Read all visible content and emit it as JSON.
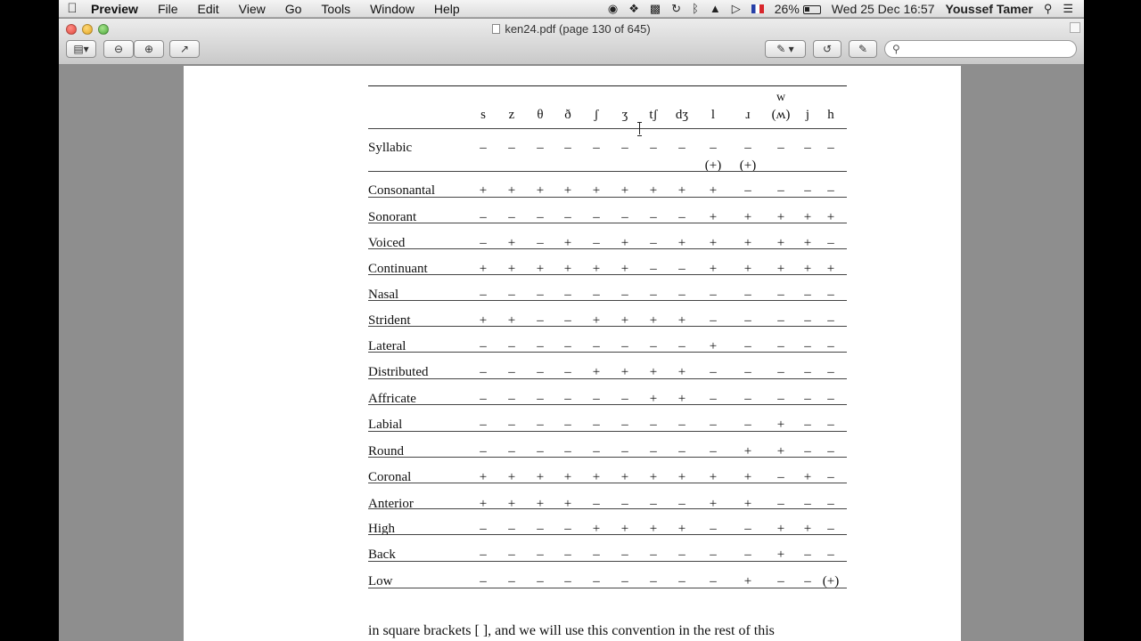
{
  "menubar": {
    "app_name": "Preview",
    "menus": [
      "File",
      "Edit",
      "View",
      "Go",
      "Tools",
      "Window",
      "Help"
    ],
    "battery": "26%",
    "datetime": "Wed 25 Dec  16:57",
    "user": "Youssef Tamer"
  },
  "window": {
    "title": "ken24.pdf (page 130 of 645)",
    "search_placeholder": ""
  },
  "table": {
    "w_superscript": "w",
    "symbols": [
      "s",
      "z",
      "θ",
      "ð",
      "ʃ",
      "ʒ",
      "tʃ",
      "dʒ",
      "l",
      "ɹ",
      "(ʍ)",
      "j",
      "h"
    ],
    "rows": [
      {
        "feature": "Syllabic",
        "values": [
          "–",
          "–",
          "–",
          "–",
          "–",
          "–",
          "–",
          "–",
          "–",
          "–",
          "–",
          "–",
          "–"
        ],
        "sub": [
          "",
          "",
          "",
          "",
          "",
          "",
          "",
          "",
          "(+)",
          "(+)",
          "",
          "",
          ""
        ]
      },
      {
        "feature": "Consonantal",
        "values": [
          "+",
          "+",
          "+",
          "+",
          "+",
          "+",
          "+",
          "+",
          "+",
          "–",
          "–",
          "–",
          "–"
        ]
      },
      {
        "feature": "Sonorant",
        "values": [
          "–",
          "–",
          "–",
          "–",
          "–",
          "–",
          "–",
          "–",
          "+",
          "+",
          "+",
          "+",
          "+"
        ]
      },
      {
        "feature": "Voiced",
        "values": [
          "–",
          "+",
          "–",
          "+",
          "–",
          "+",
          "–",
          "+",
          "+",
          "+",
          "+",
          "+",
          "–"
        ]
      },
      {
        "feature": "Continuant",
        "values": [
          "+",
          "+",
          "+",
          "+",
          "+",
          "+",
          "–",
          "–",
          "+",
          "+",
          "+",
          "+",
          "+"
        ]
      },
      {
        "feature": "Nasal",
        "values": [
          "–",
          "–",
          "–",
          "–",
          "–",
          "–",
          "–",
          "–",
          "–",
          "–",
          "–",
          "–",
          "–"
        ]
      },
      {
        "feature": "Strident",
        "values": [
          "+",
          "+",
          "–",
          "–",
          "+",
          "+",
          "+",
          "+",
          "–",
          "–",
          "–",
          "–",
          "–"
        ]
      },
      {
        "feature": "Lateral",
        "values": [
          "–",
          "–",
          "–",
          "–",
          "–",
          "–",
          "–",
          "–",
          "+",
          "–",
          "–",
          "–",
          "–"
        ]
      },
      {
        "feature": "Distributed",
        "values": [
          "–",
          "–",
          "–",
          "–",
          "+",
          "+",
          "+",
          "+",
          "–",
          "–",
          "–",
          "–",
          "–"
        ]
      },
      {
        "feature": "Affricate",
        "values": [
          "–",
          "–",
          "–",
          "–",
          "–",
          "–",
          "+",
          "+",
          "–",
          "–",
          "–",
          "–",
          "–"
        ]
      },
      {
        "feature": "Labial",
        "values": [
          "–",
          "–",
          "–",
          "–",
          "–",
          "–",
          "–",
          "–",
          "–",
          "–",
          "+",
          "–",
          "–"
        ]
      },
      {
        "feature": "Round",
        "values": [
          "–",
          "–",
          "–",
          "–",
          "–",
          "–",
          "–",
          "–",
          "–",
          "+",
          "+",
          "–",
          "–"
        ]
      },
      {
        "feature": "Coronal",
        "values": [
          "+",
          "+",
          "+",
          "+",
          "+",
          "+",
          "+",
          "+",
          "+",
          "+",
          "–",
          "+",
          "–"
        ]
      },
      {
        "feature": "Anterior",
        "values": [
          "+",
          "+",
          "+",
          "+",
          "–",
          "–",
          "–",
          "–",
          "+",
          "+",
          "–",
          "–",
          "–"
        ]
      },
      {
        "feature": "High",
        "values": [
          "–",
          "–",
          "–",
          "–",
          "+",
          "+",
          "+",
          "+",
          "–",
          "–",
          "+",
          "+",
          "–"
        ]
      },
      {
        "feature": "Back",
        "values": [
          "–",
          "–",
          "–",
          "–",
          "–",
          "–",
          "–",
          "–",
          "–",
          "–",
          "+",
          "–",
          "–"
        ]
      },
      {
        "feature": "Low",
        "values": [
          "–",
          "–",
          "–",
          "–",
          "–",
          "–",
          "–",
          "–",
          "–",
          "+",
          "–",
          "–",
          "(+)"
        ]
      }
    ]
  },
  "body_text": "in square brackets [   ], and we will use this convention in the rest of this"
}
